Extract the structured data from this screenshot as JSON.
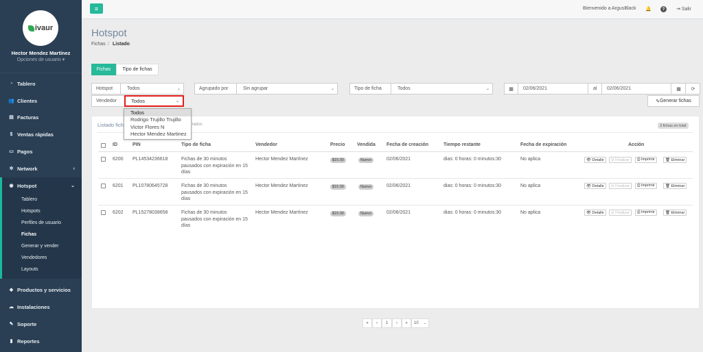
{
  "sidebar": {
    "logo_text": "ivaur",
    "user_name": "Hector Mendez Martínez",
    "user_options": "Opciones de usuario ▾",
    "items": [
      {
        "label": "Tablero",
        "icon": "dashboard-icon",
        "glyph": "◔"
      },
      {
        "label": "Clientes",
        "icon": "users-icon",
        "glyph": "👥"
      },
      {
        "label": "Facturas",
        "icon": "file-icon",
        "glyph": "▤"
      },
      {
        "label": "Ventas rápidas",
        "icon": "dollar-icon",
        "glyph": "$"
      },
      {
        "label": "Pagos",
        "icon": "money-icon",
        "glyph": "▭"
      },
      {
        "label": "Network",
        "icon": "network-icon",
        "glyph": "✲",
        "chevron": "‹"
      },
      {
        "label": "Hotspot",
        "icon": "wifi-icon",
        "glyph": "◉",
        "chevron": "⌄"
      },
      {
        "label": "Productos y servicios",
        "icon": "tag-icon",
        "glyph": "◆"
      },
      {
        "label": "Instalaciones",
        "icon": "cloud-icon",
        "glyph": "☁"
      },
      {
        "label": "Soporte",
        "icon": "wrench-icon",
        "glyph": "✎"
      },
      {
        "label": "Reportes",
        "icon": "book-icon",
        "glyph": "▮"
      }
    ],
    "hotspot_sub": [
      "Tablero",
      "Hotspots",
      "Perfiles de usuario",
      "Fichas",
      "Generar y vender",
      "Vendedores",
      "Layouts"
    ]
  },
  "topbar": {
    "welcome": "Bienvenido a ArgusBlack",
    "bell": "🔔",
    "help": "?",
    "logout": "Salir",
    "menu_glyph": "≡"
  },
  "page": {
    "title": "Hotspot",
    "breadcrumb_1": "Fichas",
    "breadcrumb_sep": "/",
    "breadcrumb_2": "Listado"
  },
  "tabs": [
    "Fichas",
    "Tipo de fichas"
  ],
  "filters": {
    "hotspot_label": "Hotspot",
    "hotspot_value": "Todos",
    "grouped_label": "Agrupado por",
    "grouped_value": "Sin agrupar",
    "type_label": "Tipo de ficha",
    "type_value": "Todos",
    "date_from": "02/06/2021",
    "date_sep": "al",
    "date_to": "02/06/2021",
    "vendor_label": "Vendedor",
    "vendor_value": "Todos",
    "generate_label": "Generar fichas"
  },
  "vendor_options": [
    "Todos",
    "Rodrigo Trujillo Trujillo",
    "Victor Flores N",
    "Hector Mendez Martinez"
  ],
  "panel": {
    "title": "Listado fich",
    "subtitle": "strados",
    "count": "3 fichas en total"
  },
  "table": {
    "headers": [
      "ID",
      "PIN",
      "Tipo de ficha",
      "Vendedor",
      "Precio",
      "Vendida",
      "Fecha de creación",
      "Tiempo restante",
      "Fecha de expiración",
      "Acción"
    ],
    "rows": [
      {
        "id": "6200",
        "pin": "PL14534236618",
        "type": "Fichas de 30 minutos pausados con expiración en 15 días",
        "seller": "Hector Mendez Martínez",
        "price": "$15.00",
        "sold": "Nuevo",
        "created": "02/06/2021",
        "remaining": "dias: 0 horas: 0 minutos:30",
        "expires": "No aplica"
      },
      {
        "id": "6201",
        "pin": "PL10780645728",
        "type": "Fichas de 30 minutos pausados con expiración en 15 días",
        "seller": "Hector Mendez Martínez",
        "price": "$15.00",
        "sold": "Nuevo",
        "created": "02/06/2021",
        "remaining": "dias: 0 horas: 0 minutos:30",
        "expires": "No aplica"
      },
      {
        "id": "6202",
        "pin": "PL15278038658",
        "type": "Fichas de 30 minutos pausados con expiración en 15 días",
        "seller": "Hector Mendez Martínez",
        "price": "$15.00",
        "sold": "Nuevo",
        "created": "02/06/2021",
        "remaining": "dias: 0 horas: 0 minutos:30",
        "expires": "No aplica"
      }
    ],
    "actions": [
      "👁 Detalle",
      "⊘ Finalizar",
      "⎙ Imprimir",
      "🗑 Eliminar"
    ]
  },
  "pagination": {
    "first": "«",
    "prev": "‹",
    "page": "1",
    "next": "›",
    "last": "»",
    "per_page": "10"
  },
  "colors": {
    "accent": "#26b99a",
    "sidebar": "#2a3f54",
    "highlight_border": "#e21b1b"
  }
}
